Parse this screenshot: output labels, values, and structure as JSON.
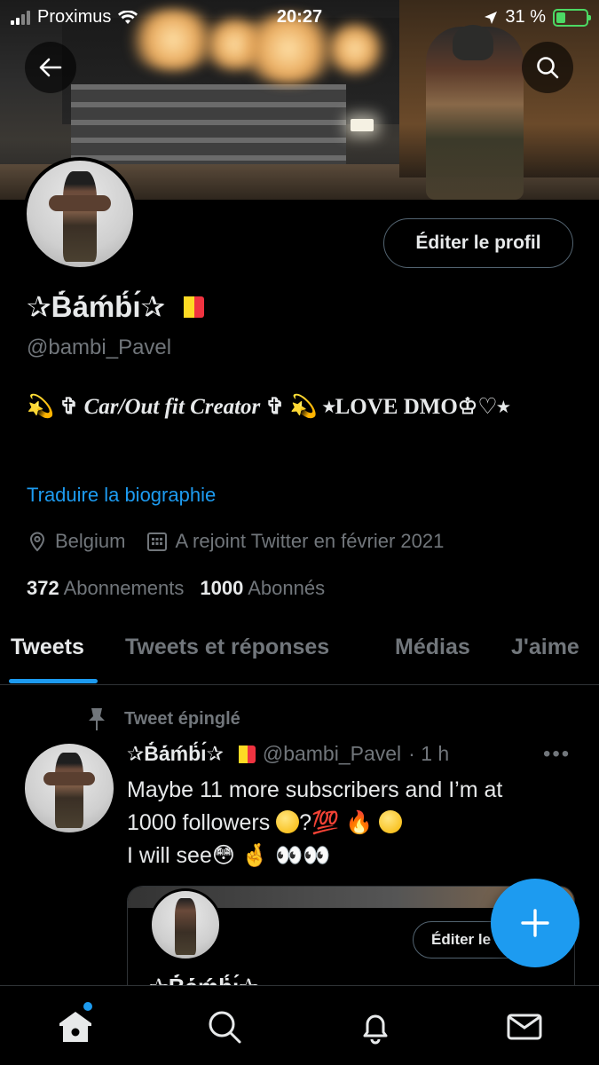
{
  "status_bar": {
    "carrier": "Proximus",
    "time": "20:27",
    "battery_percent": "31 %",
    "battery_level": 0.31
  },
  "header": {
    "back_icon": "arrow-left-icon",
    "search_icon": "search-icon"
  },
  "profile": {
    "edit_button_label": "Éditer le profil",
    "display_name": "✰Ḃ́ȧ́ḿḃ́ı́✰",
    "handle": "@bambi_Pavel",
    "bio_part1": "Car/Out fit Creator",
    "bio_part2": "⭑LOVE DMO♔♡⭑",
    "translate_label": "Traduire la biographie",
    "location": "Belgium",
    "joined": "A rejoint Twitter en février 2021",
    "following_count": "372",
    "following_label": "Abonnements",
    "followers_count": "1000",
    "followers_label": "Abonnés"
  },
  "flag_colors": [
    "#000000",
    "#FDDA24",
    "#EF3340"
  ],
  "tabs": [
    "Tweets",
    "Tweets et réponses",
    "Médias",
    "J'aime"
  ],
  "active_tab": "Tweets",
  "tweet": {
    "pinned_label": "Tweet épinglé",
    "author_name": "✰Ḃ́ȧ́ḿḃ́ı́✰",
    "author_handle": "@bambi_Pavel",
    "time_ago": "· 1 h",
    "more_label": "•••",
    "line1": "Maybe 11 more subscribers and I’m at",
    "line2": "1000 followers",
    "line3": "I will see",
    "embedded_edit_label": "Éditer le",
    "embedded_name": "✰Ḃ́ȧ́ḿḃ́ı́✰"
  },
  "fab": {
    "icon": "plus-icon"
  },
  "bottom_nav": [
    "home-icon",
    "search-icon",
    "bell-icon",
    "mail-icon"
  ],
  "colors": {
    "accent": "#1d9bf0",
    "muted": "#71767b",
    "text": "#e7e9ea",
    "background": "#000000"
  }
}
